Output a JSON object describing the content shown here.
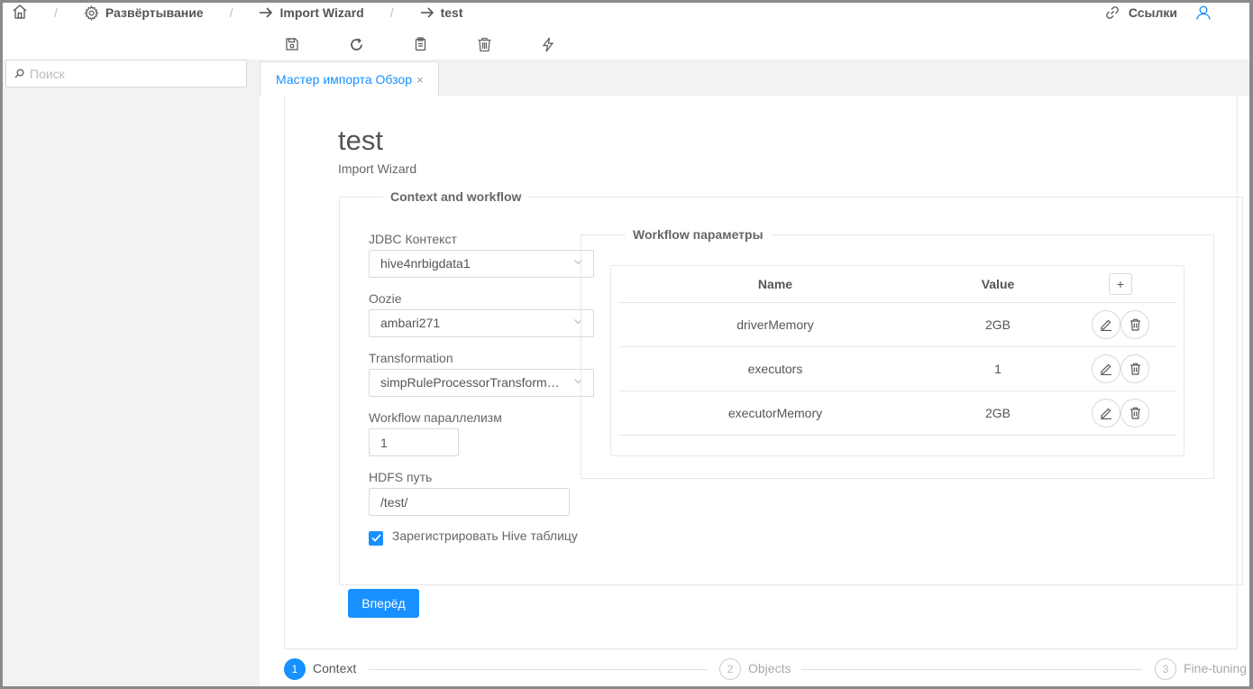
{
  "breadcrumbs": {
    "items": [
      {
        "label": "Развёртывание",
        "icon": "gear-icon"
      },
      {
        "label": "Import Wizard",
        "icon": "arrow-right-icon"
      },
      {
        "label": "test",
        "icon": "arrow-right-icon"
      }
    ],
    "separator": "/"
  },
  "header": {
    "links_label": "Ссылки"
  },
  "toolbar": {
    "icons": [
      "save-icon",
      "refresh-icon",
      "copy-icon",
      "delete-icon",
      "run-icon"
    ]
  },
  "sidebar": {
    "search_placeholder": "Поиск"
  },
  "tabs": [
    {
      "label": "Мастер импорта Обзор",
      "close": "×"
    }
  ],
  "page": {
    "title": "test",
    "subtitle": "Import Wizard"
  },
  "context": {
    "legend": "Context and workflow",
    "jdbc_label": "JDBC Контекст",
    "jdbc_value": "hive4nrbigdata1",
    "oozie_label": "Oozie",
    "oozie_value": "ambari271",
    "transformation_label": "Transformation",
    "transformation_value": "simpRuleProcessorTransformation",
    "parallelism_label": "Workflow параллелизм",
    "parallelism_value": "1",
    "hdfs_label": "HDFS путь",
    "hdfs_value": "/test/",
    "register_label": "Зарегистрировать Hive таблицу",
    "register_checked": true
  },
  "workflow": {
    "legend": "Workflow параметры",
    "columns": [
      "Name",
      "Value"
    ],
    "add_label": "+",
    "rows": [
      {
        "name": "driverMemory",
        "value": "2GB"
      },
      {
        "name": "executors",
        "value": "1"
      },
      {
        "name": "executorMemory",
        "value": "2GB"
      }
    ]
  },
  "actions": {
    "next_label": "Вперёд"
  },
  "steps": [
    {
      "num": "1",
      "label": "Context",
      "active": true
    },
    {
      "num": "2",
      "label": "Objects",
      "active": false
    },
    {
      "num": "3",
      "label": "Fine-tuning",
      "active": false
    }
  ],
  "colors": {
    "accent": "#1890ff",
    "text": "#555555",
    "border": "#d9d9d9",
    "sidebar_bg": "#f2f2f2"
  }
}
